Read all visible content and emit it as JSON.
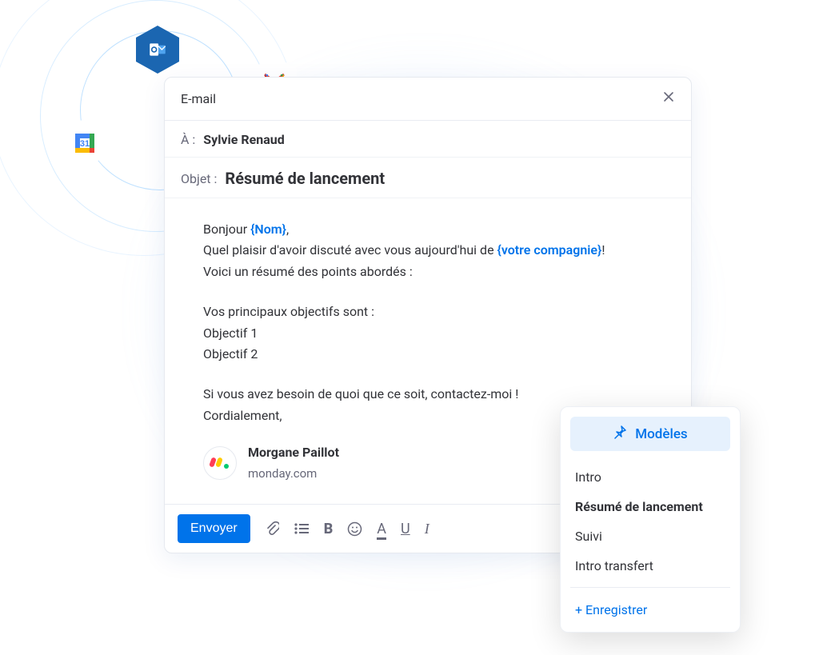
{
  "integrations": {
    "outlook": "Outlook",
    "gmail": "Gmail",
    "calendar": "Google Calendar"
  },
  "compose": {
    "title": "E-mail",
    "to_label": "À :",
    "to_value": "Sylvie Renaud",
    "subject_label": "Objet :",
    "subject_value": "Résumé de lancement",
    "body": {
      "greeting_prefix": "Bonjour ",
      "greeting_token": "{Nom}",
      "greeting_suffix": ",",
      "line2_prefix": "Quel plaisir d'avoir discuté avec vous aujourd'hui de ",
      "line2_token": "{votre compagnie}",
      "line2_suffix": "!",
      "line3": "Voici un résumé des points abordés :",
      "objectives_intro": "Vos principaux objectifs sont :",
      "objective1": "Objectif 1",
      "objective2": "Objectif 2",
      "closing1": "Si vous avez besoin de quoi que ce soit, contactez-moi !",
      "closing2": "Cordialement,"
    },
    "signature": {
      "name": "Morgane Paillot",
      "org": "monday.com"
    },
    "send_label": "Envoyer"
  },
  "templates": {
    "header": "Modèles",
    "items": [
      {
        "label": "Intro",
        "active": false
      },
      {
        "label": "Résumé de lancement",
        "active": true
      },
      {
        "label": "Suivi",
        "active": false
      },
      {
        "label": "Intro transfert",
        "active": false
      }
    ],
    "save_label": "+ Enregistrer"
  }
}
